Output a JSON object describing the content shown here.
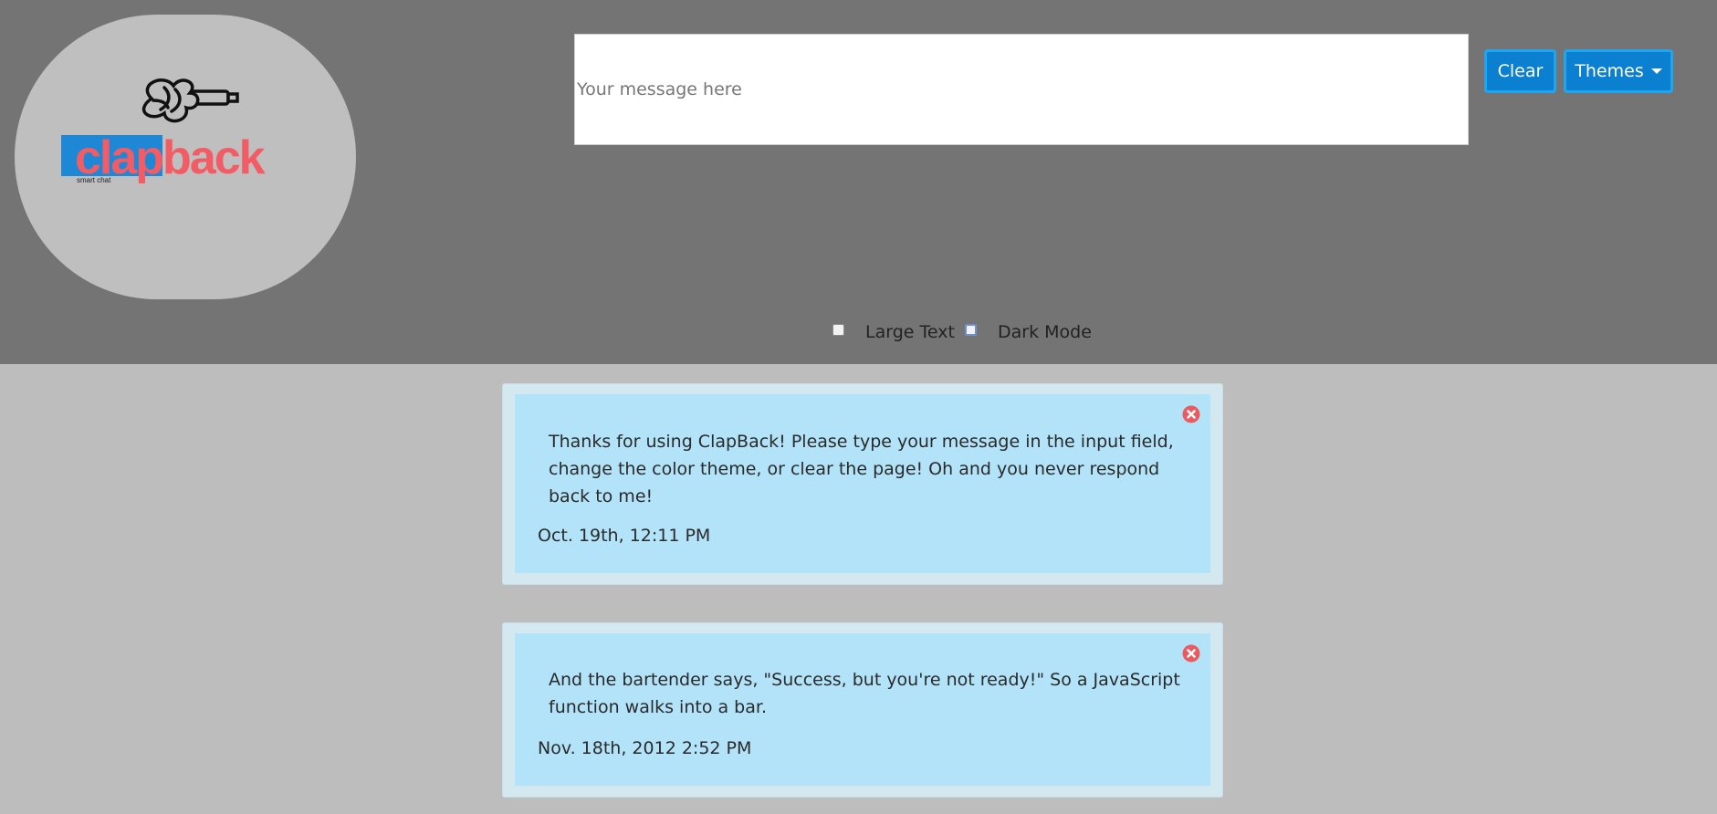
{
  "logo": {
    "name": "clapback",
    "tagline": "smart chat"
  },
  "input": {
    "placeholder": "Your message here",
    "value": ""
  },
  "toolbar": {
    "clear_label": "Clear",
    "themes_label": "Themes"
  },
  "options": {
    "large_text": {
      "label": "Large Text",
      "checked": false
    },
    "dark_mode": {
      "label": "Dark Mode",
      "checked": false
    }
  },
  "messages": [
    {
      "text": "Thanks for using ClapBack! Please type your message in the input field, change the color theme, or clear the page! Oh and you never respond back to me!",
      "timestamp": "Oct. 19th, 12:11 PM"
    },
    {
      "text": "And the bartender says, \"Success, but you're not ready!\" So a JavaScript function walks into a bar.",
      "timestamp": "Nov. 18th, 2012 2:52 PM"
    }
  ],
  "colors": {
    "header_bg": "#747474",
    "page_bg": "#bdbdbd",
    "button_bg": "#0b7fd0",
    "card_bg": "#b2e3f8",
    "logo_red": "#f25c64",
    "logo_blue": "#1e88d6"
  },
  "icons": {
    "logo": "microphone-icon",
    "dismiss": "close-icon"
  }
}
